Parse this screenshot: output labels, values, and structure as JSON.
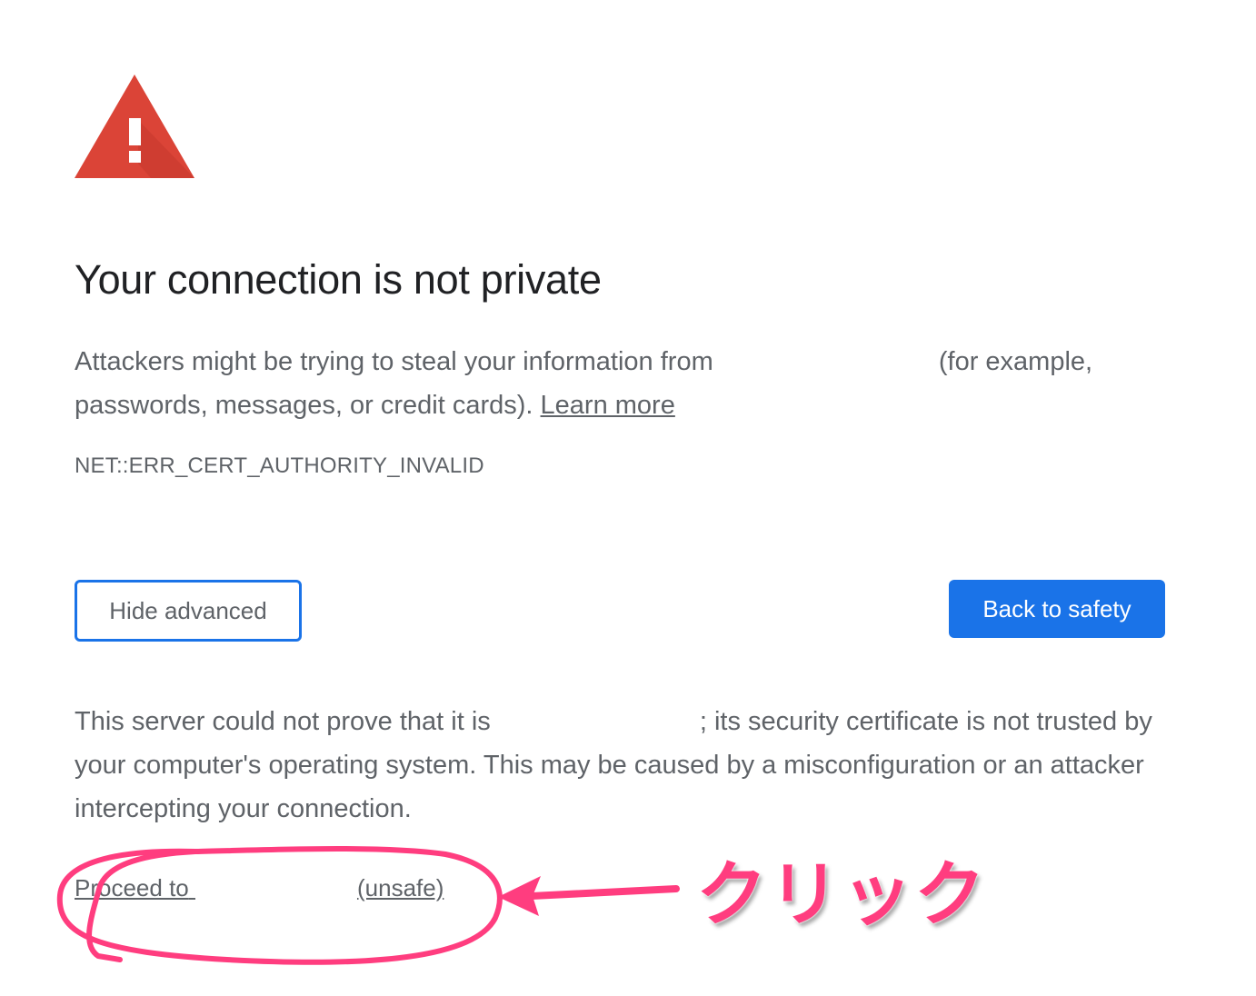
{
  "title": "Your connection is not private",
  "intro": {
    "text_before": "Attackers might be trying to steal your information from",
    "text_after": "(for example, passwords, messages, or credit cards).",
    "learn_more_label": "Learn more"
  },
  "error_code": "NET::ERR_CERT_AUTHORITY_INVALID",
  "buttons": {
    "hide_advanced_label": "Hide advanced",
    "back_to_safety_label": "Back to safety"
  },
  "details": {
    "text_before": "This server could not prove that it is",
    "text_after": "; its security certificate is not trusted by your computer's operating system. This may be caused by a misconfiguration or an attacker intercepting your connection."
  },
  "proceed": {
    "prefix": "Proceed to",
    "suffix": "(unsafe)"
  },
  "annotation": {
    "label": "クリック",
    "color": "#ff3d7f"
  },
  "colors": {
    "accent": "#1a73e8",
    "warning": "#db4437",
    "text": "#5f6368",
    "heading": "#202124"
  }
}
